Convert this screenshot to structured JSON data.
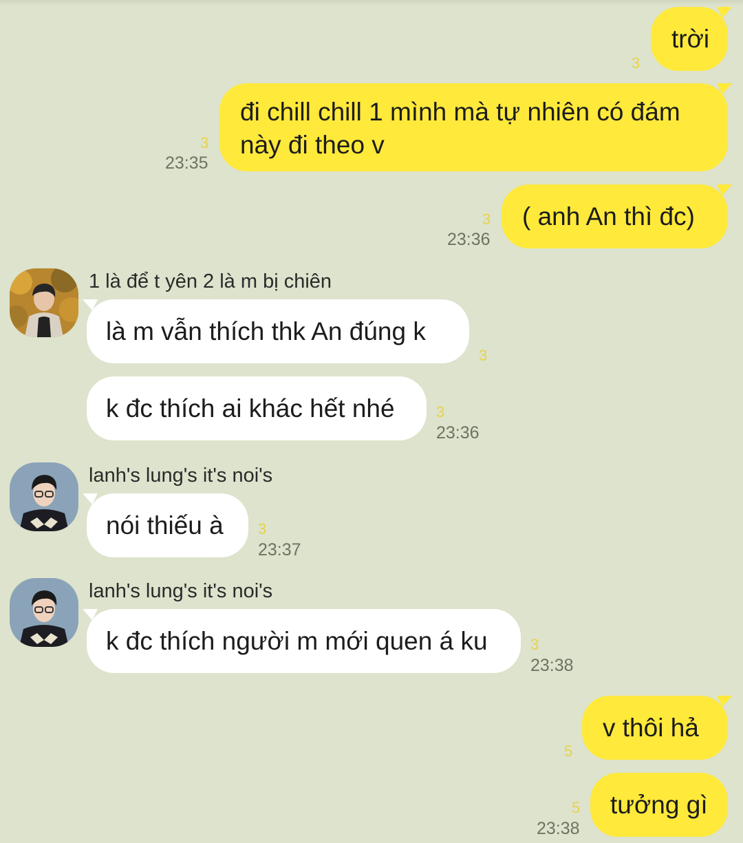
{
  "colors": {
    "background": "#dde3cc",
    "my_bubble": "#ffe93b",
    "their_bubble": "#ffffff",
    "unread_count": "#e8d24a",
    "timestamp": "#6e7263"
  },
  "messages": [
    {
      "from": "me",
      "text": "trời",
      "unread": "3",
      "time": ""
    },
    {
      "from": "me",
      "text_lines": [
        "đi chill chill 1 mình mà tự nhiên có đám",
        "này đi theo v"
      ],
      "unread": "3",
      "time": "23:35"
    },
    {
      "from": "me",
      "text": "( anh An thì đc)",
      "unread": "3",
      "time": "23:36"
    },
    {
      "from": "them",
      "sender": "1 là để t yên 2 là m bị chiên",
      "avatar": "avatar-autumn-photo",
      "text": "là m vẫn thích thk An đúng k",
      "unread": "3",
      "time": ""
    },
    {
      "from": "them",
      "text": "k đc thích ai khác hết nhé",
      "unread": "3",
      "time": "23:36"
    },
    {
      "from": "them",
      "sender": "lanh's lung's it's noi's",
      "avatar": "avatar-glasses-photo",
      "text": "nói thiếu à",
      "unread": "3",
      "time": "23:37"
    },
    {
      "from": "them",
      "sender": "lanh's lung's it's noi's",
      "avatar": "avatar-glasses-photo",
      "text": "k đc thích người m mới quen á ku",
      "unread": "3",
      "time": "23:38"
    },
    {
      "from": "me",
      "text": "v thôi hả",
      "unread": "5",
      "time": ""
    },
    {
      "from": "me",
      "text": "tưởng gì",
      "unread": "5",
      "time": "23:38"
    }
  ]
}
